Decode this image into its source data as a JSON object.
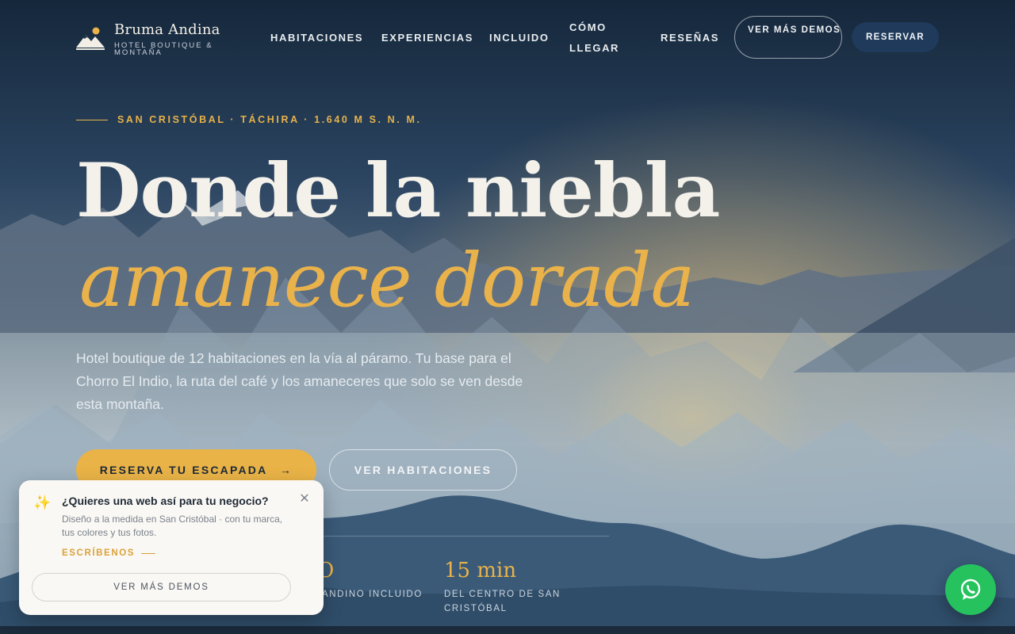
{
  "brand": {
    "name": "Bruma Andina",
    "tagline": "HOTEL BOUTIQUE & MONTAÑA",
    "logo_icon": "mountain-sun-icon"
  },
  "nav": {
    "items": [
      {
        "label": "HABITACIONES"
      },
      {
        "label": "EXPERIENCIAS"
      },
      {
        "label": "INCLUIDO"
      },
      {
        "label": "CÓMO LLEGAR"
      },
      {
        "label": "RESEÑAS"
      }
    ],
    "demos_label": "VER MÁS DEMOS",
    "reserve_label": "RESERVAR"
  },
  "hero": {
    "eyebrow": "SAN CRISTÓBAL · TÁCHIRA · 1.640 M S. N. M.",
    "title_line1": "Donde la niebla",
    "title_line2": "amanece dorada",
    "lead": "Hotel boutique de 12 habitaciones en la vía al páramo. Tu base para el Chorro El Indio, la ruta del café y los amaneceres que solo se ven desde esta montaña.",
    "cta_primary": "RESERVA TU ESCAPADA",
    "cta_primary_icon": "arrow-right-icon",
    "cta_secondary": "VER HABITACIONES"
  },
  "stats": [
    {
      "value": "O",
      "label": "ANDINO INCLUIDO"
    },
    {
      "value": "15 min",
      "label": "DEL CENTRO DE SAN CRISTÓBAL"
    }
  ],
  "popup": {
    "icon": "sparkles-icon",
    "title": "¿Quieres una web así para tu negocio?",
    "description": "Diseño a la medida en San Cristóbal · con tu marca, tus colores y tus fotos.",
    "link": "ESCRÍBENOS",
    "button": "VER MÁS DEMOS",
    "close_icon": "close-icon"
  },
  "whatsapp": {
    "icon": "whatsapp-icon"
  },
  "colors": {
    "accent": "#e9b24a",
    "primary_dark": "#1f3a5a",
    "whatsapp": "#25c25e"
  }
}
